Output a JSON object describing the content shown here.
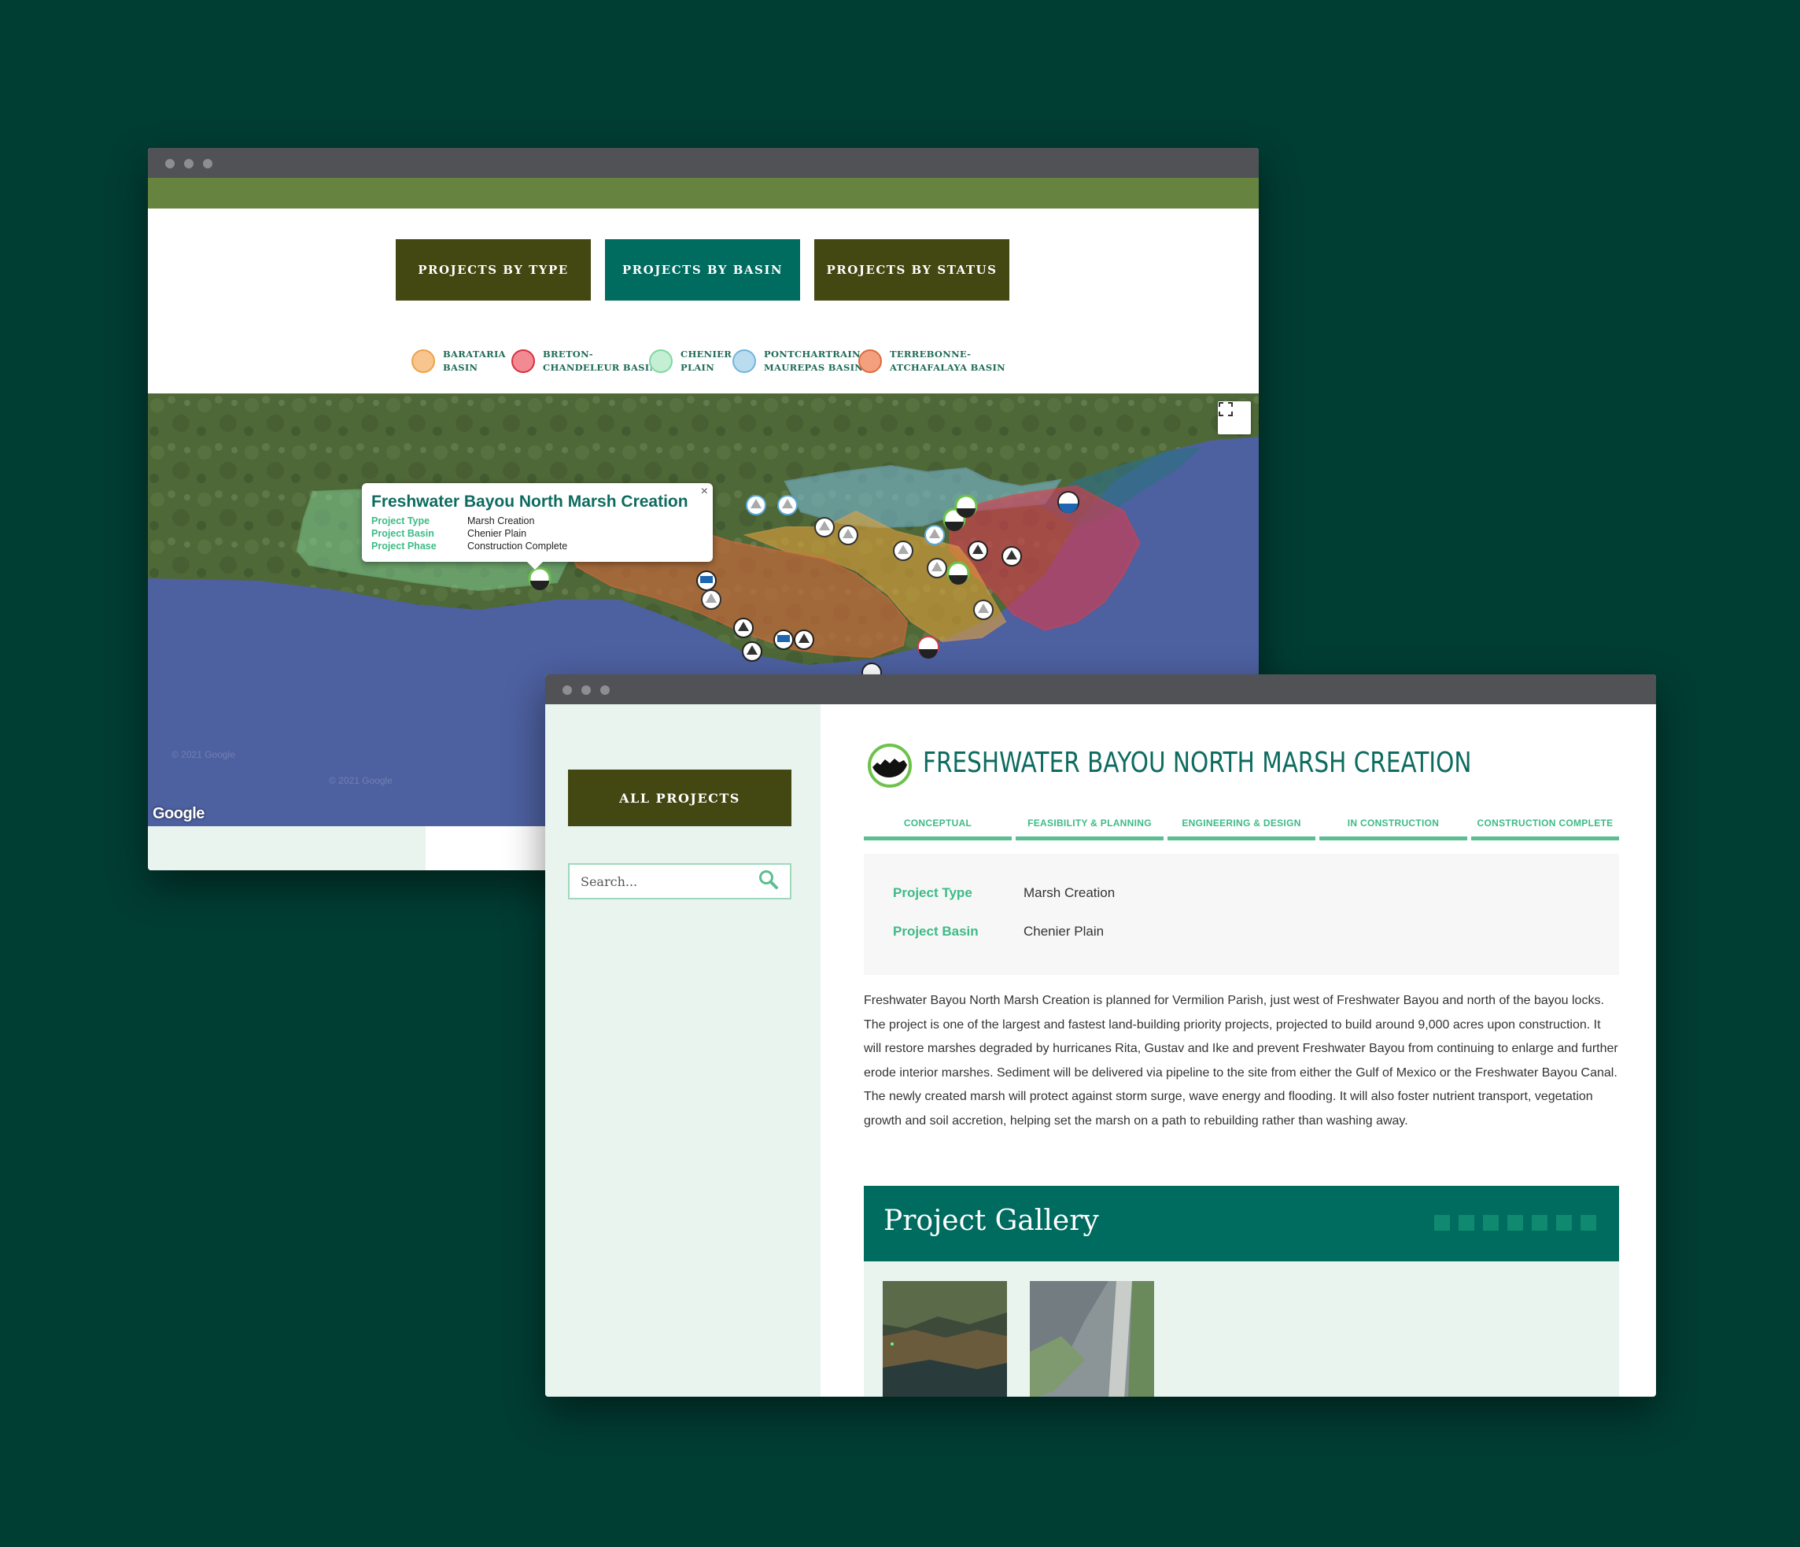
{
  "map_window": {
    "nav_buttons": [
      {
        "label": "PROJECTS BY TYPE",
        "color": "#434711"
      },
      {
        "label": "PROJECTS BY BASIN",
        "color": "#006b5f"
      },
      {
        "label": "PROJECTS BY STATUS",
        "color": "#434711"
      }
    ],
    "legend": [
      {
        "label": "BARATARIA\nBASIN",
        "fill": "#f7c58d",
        "stroke": "#eba24a"
      },
      {
        "label": "BRETON-\nCHANDELEUR BASIN",
        "fill": "#f28a93",
        "stroke": "#d7313f"
      },
      {
        "label": "CHENIER\nPLAIN",
        "fill": "#c4efd4",
        "stroke": "#7fd79e"
      },
      {
        "label": "PONTCHARTRAIN-\nMAUREPAS BASIN",
        "fill": "#b9dcef",
        "stroke": "#72b4dc"
      },
      {
        "label": "TERREBONNE-\nATCHAFALAYA BASIN",
        "fill": "#f4a07f",
        "stroke": "#de6a3c"
      }
    ],
    "popup": {
      "title": "Freshwater Bayou North Marsh Creation",
      "close": "×",
      "rows": [
        {
          "key": "Project Type",
          "value": "Marsh Creation"
        },
        {
          "key": "Project Basin",
          "value": "Chenier Plain"
        },
        {
          "key": "Project Phase",
          "value": "Construction Complete"
        }
      ]
    },
    "google_logo": "Google",
    "copyright": "© 2021 Google",
    "fullscreen_icon": "fullscreen-icon"
  },
  "detail_window": {
    "all_projects_label": "ALL PROJECTS",
    "search_placeholder": "Search...",
    "title": "FRESHWATER BAYOU NORTH MARSH CREATION",
    "phases": [
      "CONCEPTUAL",
      "FEASIBILITY & PLANNING",
      "ENGINEERING & DESIGN",
      "IN CONSTRUCTION",
      "CONSTRUCTION COMPLETE"
    ],
    "info": [
      {
        "key": "Project Type",
        "value": "Marsh Creation"
      },
      {
        "key": "Project Basin",
        "value": "Chenier Plain"
      }
    ],
    "description": "Freshwater Bayou North Marsh Creation is planned for Vermilion Parish, just west of Freshwater Bayou and north of the bayou locks. The project is one of the largest and fastest land-building priority projects, projected to build around 9,000 acres upon construction. It will restore marshes degraded by hurricanes Rita, Gustav and Ike and prevent Freshwater Bayou from continuing to enlarge and further erode interior marshes. Sediment will be delivered via pipeline to the site from either the Gulf of Mexico or the Freshwater Bayou Canal. The newly created marsh will protect against storm surge, wave energy and flooding. It will also foster nutrient transport, vegetation growth and soil accretion, helping set the marsh on a path to rebuilding rather than washing away.",
    "gallery_title": "Project Gallery",
    "accent_color": "#3dbb86"
  }
}
